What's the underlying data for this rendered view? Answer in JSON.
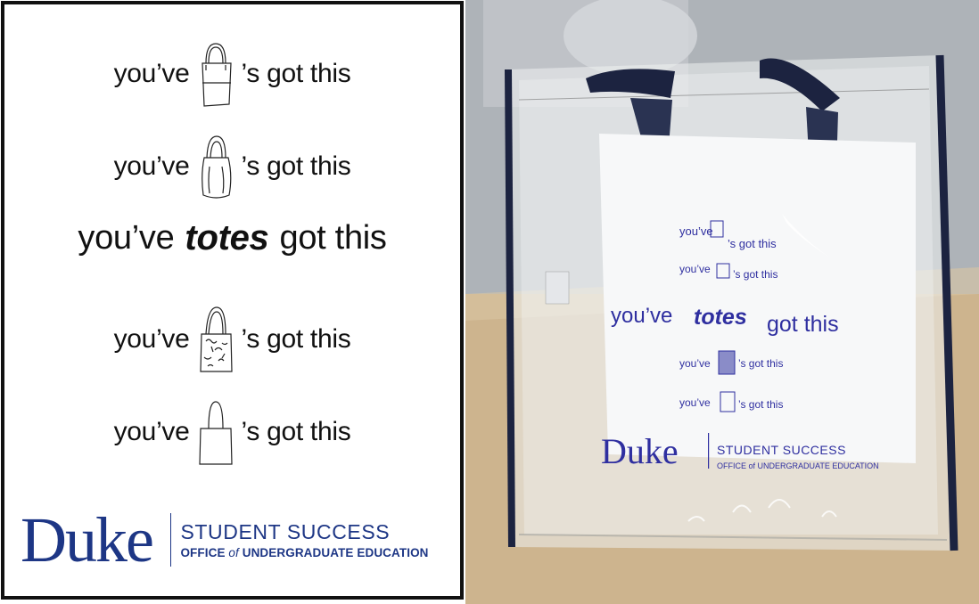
{
  "design": {
    "lines": [
      {
        "before": "you’ve",
        "after": "’s got this",
        "icon": "tote-bag-structured-icon"
      },
      {
        "before": "you’ve",
        "after": "’s got this",
        "icon": "tote-bag-slouchy-icon"
      },
      {
        "before": "you’ve",
        "bold": "totes",
        "after": "got this"
      },
      {
        "before": "you’ve",
        "after": "’s got this",
        "icon": "tote-bag-patterned-icon"
      },
      {
        "before": "you’ve",
        "after": "’s got this",
        "icon": "tote-bag-plain-icon"
      }
    ],
    "logo": {
      "wordmark": "Duke",
      "line1": "STUDENT SUCCESS",
      "line2_pre": "OFFICE ",
      "line2_of": "of",
      "line2_post": " UNDERGRADUATE EDUCATION"
    }
  },
  "photo": {
    "bag_lines": [
      {
        "before": "you’ve",
        "after": "’s got this"
      },
      {
        "before": "you’ve",
        "after": "’s got this"
      },
      {
        "before": "you’ve",
        "bold": "totes",
        "after": "got this"
      },
      {
        "before": "you’ve",
        "after": "’s got this"
      },
      {
        "before": "you’ve",
        "after": "’s got this"
      }
    ],
    "bag_logo": {
      "wordmark": "Duke",
      "line1": "STUDENT SUCCESS",
      "line2": "OFFICE of UNDERGRADUATE EDUCATION"
    }
  },
  "colors": {
    "duke_blue": "#1d3685",
    "print_blue": "#2f2fa0",
    "handle_navy": "#1c2340"
  }
}
